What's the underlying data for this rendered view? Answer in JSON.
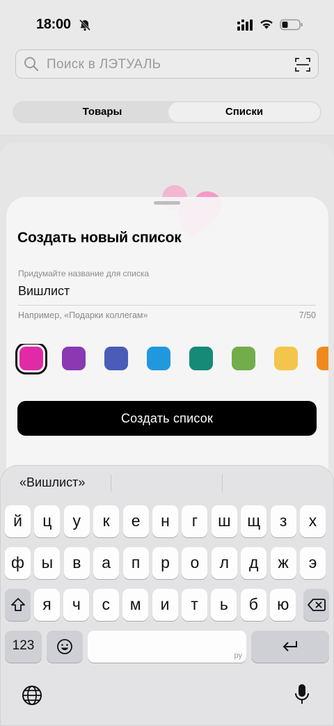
{
  "status": {
    "time": "18:00"
  },
  "search": {
    "placeholder": "Поиск в ЛЭТУАЛЬ"
  },
  "tabs": {
    "products": "Товары",
    "lists": "Списки"
  },
  "sheet": {
    "title": "Создать новый список",
    "field_label": "Придумайте название для списка",
    "field_value": "Вишлист",
    "hint": "Например, «Подарки коллегам»",
    "counter": "7/50",
    "colors": [
      "#e02aa6",
      "#8a39b3",
      "#4a5bb8",
      "#2198de",
      "#168a77",
      "#72ad4a",
      "#f4c54c",
      "#f08a1e"
    ],
    "selected_color": "#e02aa6",
    "create_button": "Создать список"
  },
  "keyboard": {
    "suggestion": "«Вишлист»",
    "row1": [
      "й",
      "ц",
      "у",
      "к",
      "е",
      "н",
      "г",
      "ш",
      "щ",
      "з",
      "х"
    ],
    "row2": [
      "ф",
      "ы",
      "в",
      "а",
      "п",
      "р",
      "о",
      "л",
      "д",
      "ж",
      "э"
    ],
    "row3": [
      "я",
      "ч",
      "с",
      "м",
      "и",
      "т",
      "ь",
      "б",
      "ю"
    ],
    "num_key": "123",
    "space_lang": "ру"
  }
}
